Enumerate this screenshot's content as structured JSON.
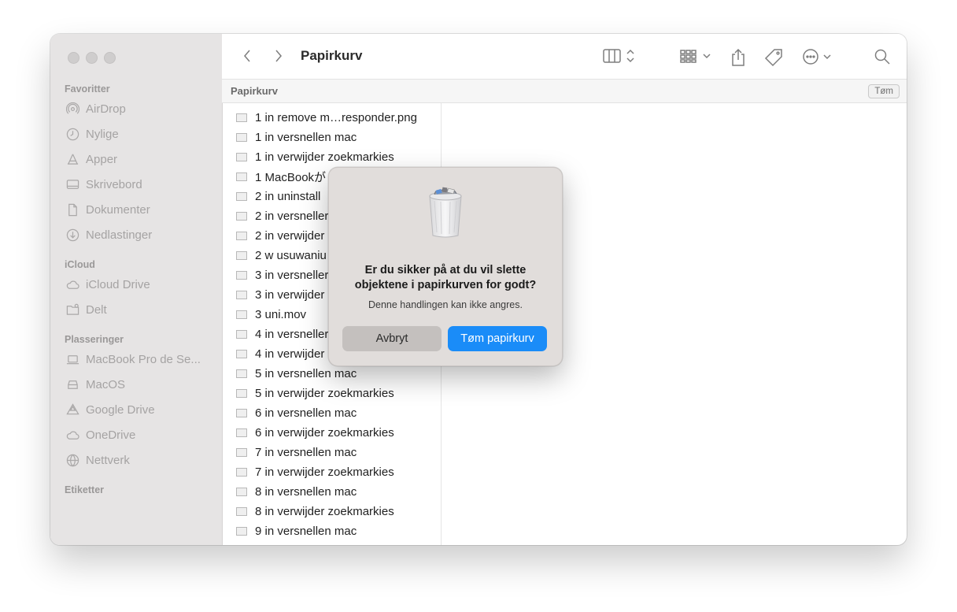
{
  "window": {
    "title": "Papirkurv"
  },
  "sidebar": {
    "sections": [
      {
        "heading": "Favoritter",
        "items": [
          {
            "label": "AirDrop",
            "icon": "airdrop-icon"
          },
          {
            "label": "Nylige",
            "icon": "clock-icon"
          },
          {
            "label": "Apper",
            "icon": "apps-icon"
          },
          {
            "label": "Skrivebord",
            "icon": "desktop-icon"
          },
          {
            "label": "Dokumenter",
            "icon": "document-icon"
          },
          {
            "label": "Nedlastinger",
            "icon": "download-icon"
          }
        ]
      },
      {
        "heading": "iCloud",
        "items": [
          {
            "label": "iCloud Drive",
            "icon": "cloud-icon"
          },
          {
            "label": "Delt",
            "icon": "shared-folder-icon"
          }
        ]
      },
      {
        "heading": "Plasseringer",
        "items": [
          {
            "label": "MacBook Pro de Se...",
            "icon": "laptop-icon"
          },
          {
            "label": "MacOS",
            "icon": "disk-icon"
          },
          {
            "label": "Google Drive",
            "icon": "google-drive-icon"
          },
          {
            "label": "OneDrive",
            "icon": "cloud-icon"
          },
          {
            "label": "Nettverk",
            "icon": "network-icon"
          }
        ]
      },
      {
        "heading": "Etiketter",
        "items": []
      }
    ]
  },
  "pathbar": {
    "label": "Papirkurv",
    "empty_button": "Tøm"
  },
  "files": [
    "1 in remove m…responder.png",
    "1 in versnellen mac",
    "1 in verwijder zoekmarkies",
    "1 MacBookが",
    "2 in uninstall",
    "2 in versneller",
    "2 in verwijder",
    "2 w usuwaniu",
    "3 in versneller",
    "3 in verwijder",
    "3 uni.mov",
    "4 in versneller",
    "4 in verwijder",
    "5 in versnellen mac",
    "5 in verwijder zoekmarkies",
    "6 in versnellen mac",
    "6 in verwijder zoekmarkies",
    "7 in versnellen mac",
    "7 in verwijder zoekmarkies",
    "8 in versnellen mac",
    "8 in verwijder zoekmarkies",
    "9 in versnellen mac"
  ],
  "dialog": {
    "message": "Er du sikker på at du vil slette objektene i papirkurven for godt?",
    "info": "Denne handlingen kan ikke angres.",
    "cancel": "Avbryt",
    "confirm": "Tøm papirkurv"
  },
  "colors": {
    "accent": "#1a8cf8",
    "sidebar_bg": "#e6e4e4",
    "dialog_bg": "#e1dddb"
  }
}
